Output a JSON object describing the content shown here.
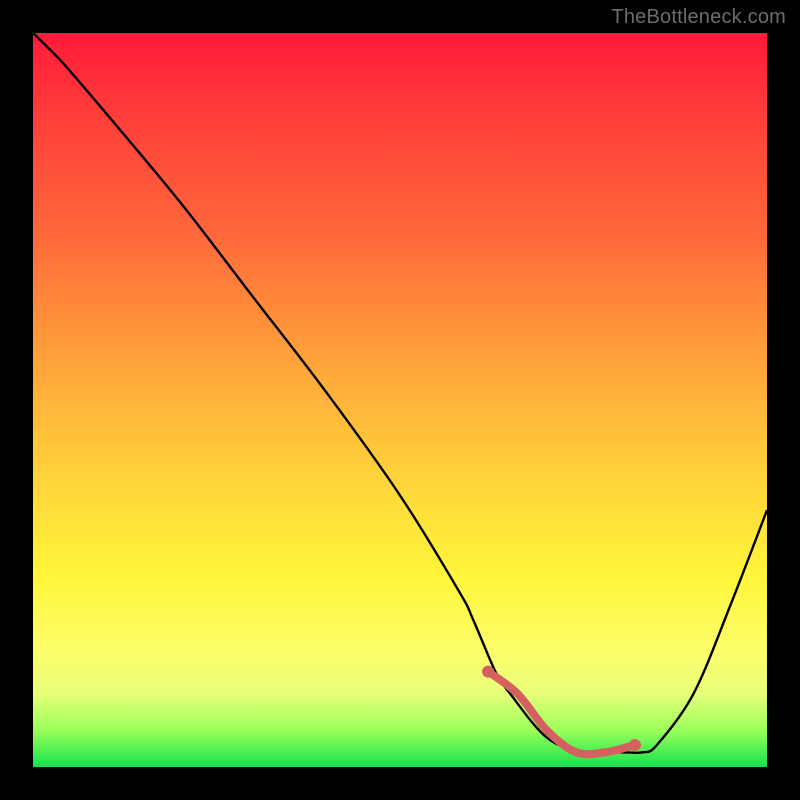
{
  "attribution": "TheBottleneck.com",
  "chart_data": {
    "type": "line",
    "title": "",
    "xlabel": "",
    "ylabel": "",
    "xlim": [
      0,
      100
    ],
    "ylim": [
      0,
      100
    ],
    "series": [
      {
        "name": "bottleneck-curve",
        "x": [
          0,
          4,
          10,
          20,
          30,
          40,
          50,
          58,
          60,
          63,
          65,
          70,
          75,
          80,
          83,
          85,
          90,
          95,
          100
        ],
        "y": [
          100,
          96,
          89,
          77,
          64,
          51,
          37,
          24,
          20,
          13,
          10,
          4,
          2,
          2,
          2,
          3,
          10,
          22,
          35
        ]
      },
      {
        "name": "optimal-range-highlight",
        "x": [
          62,
          66,
          70,
          74,
          78,
          82
        ],
        "y": [
          13,
          10,
          5,
          2,
          2,
          3
        ]
      }
    ],
    "gradient_stops": [
      {
        "pos": 0,
        "color": "#ff1a3a"
      },
      {
        "pos": 10,
        "color": "#ff3a3a"
      },
      {
        "pos": 28,
        "color": "#ff6a3a"
      },
      {
        "pos": 42,
        "color": "#ff9a3a"
      },
      {
        "pos": 60,
        "color": "#ffd23a"
      },
      {
        "pos": 74,
        "color": "#fff53a"
      },
      {
        "pos": 84,
        "color": "#fdfe6a"
      },
      {
        "pos": 90,
        "color": "#e8ff7a"
      },
      {
        "pos": 95,
        "color": "#9aff5a"
      },
      {
        "pos": 100,
        "color": "#17e24e"
      }
    ],
    "highlight_color": "#d46060"
  }
}
